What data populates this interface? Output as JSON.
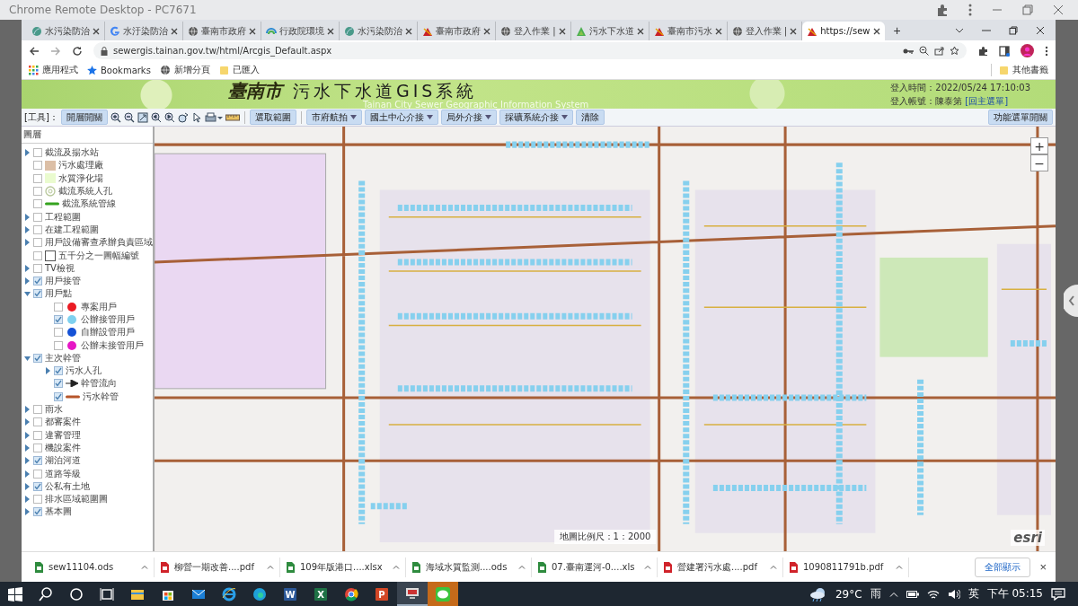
{
  "remote_window": {
    "title": "Chrome Remote Desktop - PC7671"
  },
  "browser": {
    "tabs": [
      {
        "title": "水污染防治",
        "kind": "site",
        "selected": false
      },
      {
        "title": "水汙染防治",
        "kind": "google",
        "selected": false
      },
      {
        "title": "臺南市政府",
        "kind": "globe",
        "selected": false
      },
      {
        "title": "行政院環境",
        "kind": "epa",
        "selected": false
      },
      {
        "title": "水污染防治",
        "kind": "site",
        "selected": false
      },
      {
        "title": "臺南市政府",
        "kind": "tainan",
        "selected": false
      },
      {
        "title": "登入作業 |",
        "kind": "globe",
        "selected": false
      },
      {
        "title": "污水下水道",
        "kind": "triangle",
        "selected": false
      },
      {
        "title": "臺南市污水",
        "kind": "tainan",
        "selected": false
      },
      {
        "title": "登入作業 |",
        "kind": "globe",
        "selected": false
      },
      {
        "title": "https://sew",
        "kind": "tainan",
        "selected": true
      }
    ],
    "new_tab": "+",
    "url": "sewergis.tainan.gov.tw/html/Arcgis_Default.aspx",
    "bookmarks": [
      {
        "label": "應用程式",
        "kind": "apps"
      },
      {
        "label": "Bookmarks",
        "kind": "star"
      },
      {
        "label": "新增分頁",
        "kind": "globe"
      },
      {
        "label": "已匯入",
        "kind": "folder"
      }
    ],
    "other_bookmarks": "其他書籤"
  },
  "page": {
    "header": {
      "city": "臺南市",
      "title": "污水下水道GIS系統",
      "subtitle": "Tainan City Sewer Geographic Information System",
      "login_time": "登入時間：2022/05/24 17:10:03",
      "account": "登入帳號：陳泰第",
      "menu_link": "[回主選單]"
    },
    "toolbar": {
      "label": "[工具]：",
      "layer_toggle": "開層開關",
      "select_button": "選取範圍",
      "menus": [
        {
          "label": "市府航拍",
          "kind": "dropdown"
        },
        {
          "label": "國土中心介接",
          "kind": "dropdown"
        },
        {
          "label": "局外介接",
          "kind": "dropdown"
        },
        {
          "label": "採礦系統介接",
          "kind": "dropdown"
        },
        {
          "label": "清除",
          "kind": "button"
        }
      ],
      "function_menu": "功能選單開關"
    },
    "layer_panel": {
      "title": "圖層",
      "layers": [
        {
          "label": "截流及揚水站",
          "checked": false,
          "expanded": false
        },
        {
          "label": "污水處理廠",
          "checked": false,
          "kind": "fill",
          "color": "#dcbfa6"
        },
        {
          "label": "水質淨化場",
          "checked": false,
          "kind": "fill",
          "color": "#eafbcf"
        },
        {
          "label": "截流系統人孔",
          "checked": false,
          "kind": "ring",
          "color": "#b7c79a"
        },
        {
          "label": "截流系統管線",
          "checked": false,
          "kind": "line",
          "color": "#35a31f"
        },
        {
          "label": "工程範圍",
          "checked": false,
          "expanded": false
        },
        {
          "label": "在建工程範圍",
          "checked": false,
          "expanded": false
        },
        {
          "label": "用戶設備審查承辦負責區域",
          "checked": false,
          "expanded": false
        },
        {
          "label": "五千分之一圖幅編號",
          "checked": false,
          "kind": "box",
          "color": "#555555"
        },
        {
          "label": "TV檢視",
          "checked": false,
          "expanded": false
        },
        {
          "label": "用戶接管",
          "checked": true,
          "expanded": false
        },
        {
          "label": "用戶點",
          "checked": true,
          "expanded": true,
          "children": [
            {
              "label": "專案用戶",
              "checked": false,
              "kind": "dot",
              "color": "#ea1b23"
            },
            {
              "label": "公辦接管用戶",
              "checked": true,
              "kind": "dot",
              "color": "#7fd1ef"
            },
            {
              "label": "自辦設管用戶",
              "checked": false,
              "kind": "dot",
              "color": "#1552d6"
            },
            {
              "label": "公辦未接管用戶",
              "checked": false,
              "kind": "dot",
              "color": "#e617c5"
            }
          ]
        },
        {
          "label": "主次幹管",
          "checked": true,
          "expanded": true,
          "children": [
            {
              "label": "污水人孔",
              "checked": true,
              "expanded": false
            },
            {
              "label": "幹管流向",
              "checked": true,
              "kind": "arrow",
              "color": "#222222"
            },
            {
              "label": "污水幹管",
              "checked": true,
              "kind": "line",
              "color": "#b6552a"
            }
          ]
        },
        {
          "label": "雨水",
          "checked": false,
          "expanded": false
        },
        {
          "label": "都審案件",
          "checked": false,
          "expanded": false
        },
        {
          "label": "違審管理",
          "checked": false,
          "expanded": false
        },
        {
          "label": "機說案件",
          "checked": false,
          "expanded": false
        },
        {
          "label": "湖泊河道",
          "checked": true,
          "expanded": false
        },
        {
          "label": "道路等級",
          "checked": false,
          "expanded": false
        },
        {
          "label": "公私有土地",
          "checked": true,
          "expanded": false
        },
        {
          "label": "排水區域範圍圖",
          "checked": false,
          "expanded": false
        },
        {
          "label": "基本圖",
          "checked": true,
          "expanded": false
        }
      ]
    },
    "map": {
      "kind": "picture",
      "zoom_in": "+",
      "zoom_out": "−",
      "scale": "地圖比例尺：1：2000",
      "attribution": "esri"
    }
  },
  "downloads": {
    "items": [
      {
        "name": "sew11104.ods",
        "kind": "ods"
      },
      {
        "name": "柳營一期改善....pdf",
        "kind": "pdf"
      },
      {
        "name": "109年版港口....xlsx",
        "kind": "xlsx"
      },
      {
        "name": "海域水質監測....ods",
        "kind": "ods"
      },
      {
        "name": "07.臺南運河-0....xls",
        "kind": "xls"
      },
      {
        "name": "營建署污水處....pdf",
        "kind": "pdf"
      },
      {
        "name": "1090811791b.pdf",
        "kind": "pdf"
      }
    ],
    "show_all": "全部顯示",
    "close": "×"
  },
  "taskbar": {
    "apps": [
      {
        "kind": "explorer",
        "active": false,
        "attention": false
      },
      {
        "kind": "store",
        "active": false,
        "attention": false
      },
      {
        "kind": "mail",
        "active": false,
        "attention": false
      },
      {
        "kind": "ie",
        "active": false,
        "attention": false
      },
      {
        "kind": "edge",
        "active": false,
        "attention": false
      },
      {
        "kind": "word",
        "label": "W",
        "active": false,
        "attention": false
      },
      {
        "kind": "excel",
        "label": "X",
        "active": false,
        "attention": false
      },
      {
        "kind": "chrome",
        "active": false,
        "attention": false
      },
      {
        "kind": "powerpoint",
        "label": "P",
        "active": false,
        "attention": false
      },
      {
        "kind": "remote",
        "active": true,
        "attention": false
      },
      {
        "kind": "line",
        "active": false,
        "attention": true
      }
    ],
    "temperature": "29°C",
    "weather": "雨",
    "ime": "英",
    "clock": "下午 05:15"
  }
}
